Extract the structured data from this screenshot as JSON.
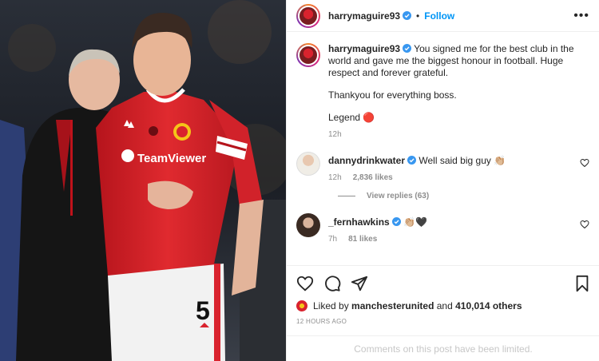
{
  "post": {
    "author": "harrymaguire93",
    "follow_label": "Follow",
    "more_icon": "more-options-icon"
  },
  "caption": {
    "username": "harrymaguire93",
    "line1": "You signed me for the best club in the world and gave me the biggest honour in football. Huge respect and forever grateful.",
    "line2": "Thankyou for everything boss.",
    "line3": "Legend 🔴",
    "time": "12h"
  },
  "comments": [
    {
      "username": "dannydrinkwater",
      "text": "Well said big guy 👏🏼",
      "time": "12h",
      "likes": "2,836 likes",
      "view_replies": "View replies (63)"
    },
    {
      "username": "_fernhawkins",
      "text": "👏🏼🖤",
      "time": "7h",
      "likes": "81 likes"
    }
  ],
  "likes": {
    "prefix": "Liked by",
    "user": "manchesterunited",
    "middle": "and",
    "count": "410,014 others"
  },
  "timestamp": "12 HOURS AGO",
  "comments_limited": "Comments on this post have been limited.",
  "colors": {
    "accent": "#0095f6",
    "united_red": "#d9232e",
    "verified": "#3897f0"
  },
  "photo": {
    "kit_sponsor": "TeamViewer",
    "shirt_number": "5"
  }
}
